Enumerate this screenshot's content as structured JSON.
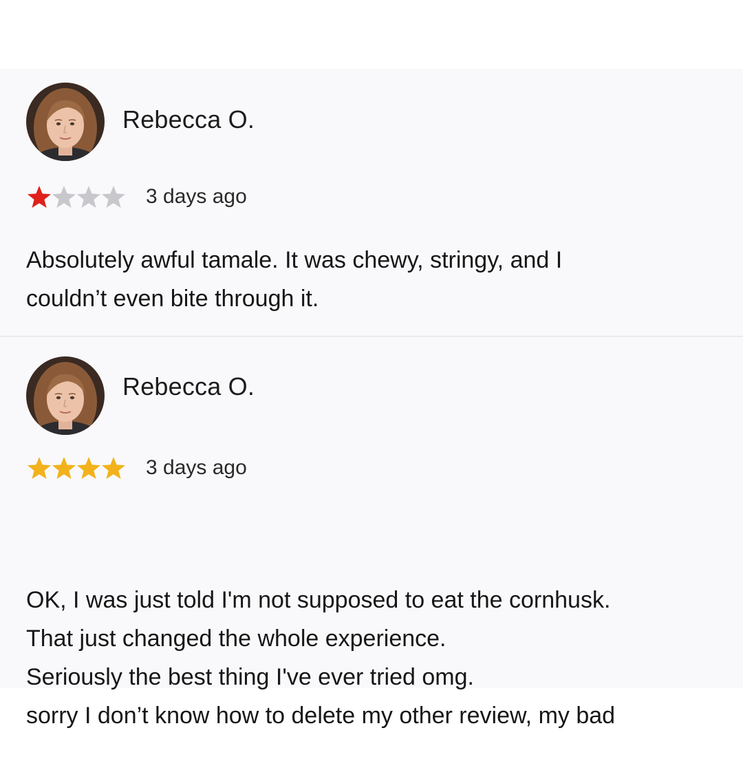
{
  "reviews": [
    {
      "reviewer_name": "Rebecca O.",
      "rating": 1,
      "max_rating": 4,
      "timestamp": "3 days ago",
      "star_color": "#e0201b",
      "star_empty_color": "#c8c8cc",
      "avatar_icon": "reviewer-photo",
      "body_lines": [
        "Absolutely awful tamale. It was chewy, stringy, and I",
        "couldn’t even bite through it."
      ]
    },
    {
      "reviewer_name": "Rebecca O.",
      "rating": 4,
      "max_rating": 4,
      "timestamp": "3 days ago",
      "star_color": "#f2b21b",
      "star_empty_color": "#c8c8cc",
      "avatar_icon": "reviewer-photo",
      "body_lines": [
        "OK, I was just told I'm not supposed to eat the cornhusk.",
        "That just changed the whole experience.",
        "Seriously the best thing I've ever tried omg.",
        "sorry I don’t know how to delete my other review, my bad"
      ]
    }
  ],
  "colors": {
    "page_background": "#ffffff",
    "card_background": "#f9f9fb",
    "divider": "#ebebed",
    "text": "#161616"
  }
}
